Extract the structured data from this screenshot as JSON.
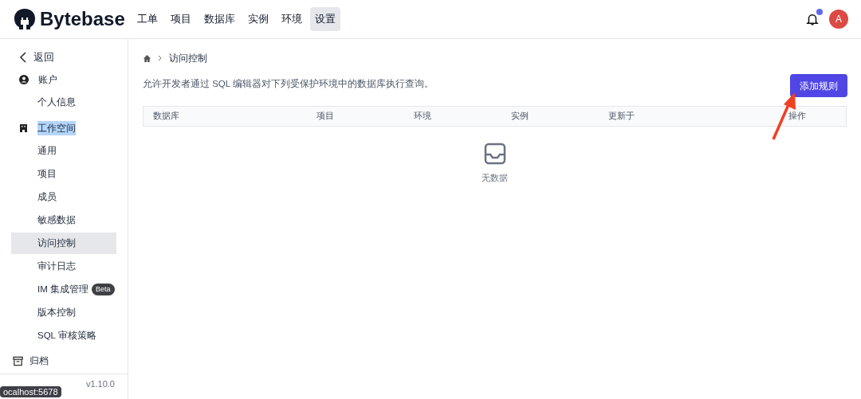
{
  "header": {
    "logo": "Bytebase",
    "nav": [
      {
        "label": "工单",
        "selected": false
      },
      {
        "label": "项目",
        "selected": false
      },
      {
        "label": "数据库",
        "selected": false
      },
      {
        "label": "实例",
        "selected": false
      },
      {
        "label": "环境",
        "selected": false
      },
      {
        "label": "设置",
        "selected": true
      }
    ],
    "notification_dot": true,
    "avatar": "A"
  },
  "sidebar": {
    "back": "返回",
    "sections": [
      {
        "label": "账户",
        "kind": "account",
        "highlighted": false,
        "items": [
          {
            "label": "个人信息",
            "selected": false
          }
        ]
      },
      {
        "label": "工作空间",
        "kind": "workspace",
        "highlighted": true,
        "items": [
          {
            "label": "通用",
            "selected": false
          },
          {
            "label": "项目",
            "selected": false
          },
          {
            "label": "成员",
            "selected": false
          },
          {
            "label": "敏感数据",
            "selected": false
          },
          {
            "label": "访问控制",
            "selected": true
          },
          {
            "label": "审计日志",
            "selected": false
          },
          {
            "label": "IM 集成管理",
            "badge": "Beta",
            "selected": false
          },
          {
            "label": "版本控制",
            "selected": false
          },
          {
            "label": "SQL 审核策略",
            "selected": false
          }
        ]
      }
    ],
    "archive": "归档",
    "version": "v1.10.0",
    "tooltip": "ocalhost:5678"
  },
  "breadcrumb": {
    "current": "访问控制"
  },
  "description": "允许开发者通过 SQL 编辑器对下列受保护环境中的数据库执行查询。",
  "add_button": "添加规则",
  "table": {
    "columns": [
      "数据库",
      "项目",
      "环境",
      "实例",
      "更新于",
      "操作"
    ],
    "empty_text": "无数据"
  }
}
